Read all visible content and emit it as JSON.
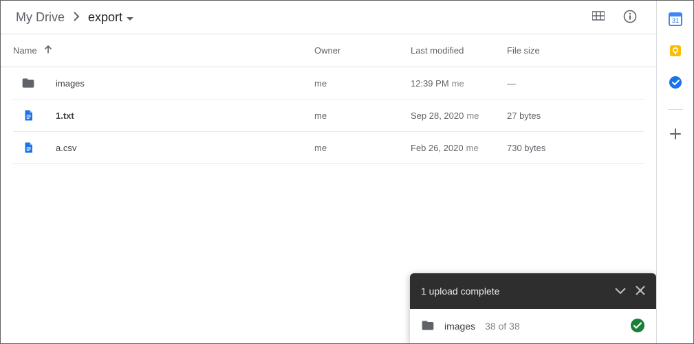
{
  "breadcrumb": {
    "parent": "My Drive",
    "current": "export"
  },
  "columns": {
    "name": "Name",
    "owner": "Owner",
    "modified": "Last modified",
    "size": "File size"
  },
  "rows": [
    {
      "icon": "folder",
      "name": "images",
      "owner": "me",
      "modified": "12:39 PM",
      "modified_by": "me",
      "size": "—"
    },
    {
      "icon": "doc",
      "name": "1.txt",
      "owner": "me",
      "modified": "Sep 28, 2020",
      "modified_by": "me",
      "size": "27 bytes"
    },
    {
      "icon": "doc",
      "name": "a.csv",
      "owner": "me",
      "modified": "Feb 26, 2020",
      "modified_by": "me",
      "size": "730 bytes"
    }
  ],
  "upload": {
    "title": "1 upload complete",
    "item_name": "images",
    "progress": "38 of 38",
    "status": "complete"
  },
  "sidepanel": {
    "calendar_day": "31"
  }
}
